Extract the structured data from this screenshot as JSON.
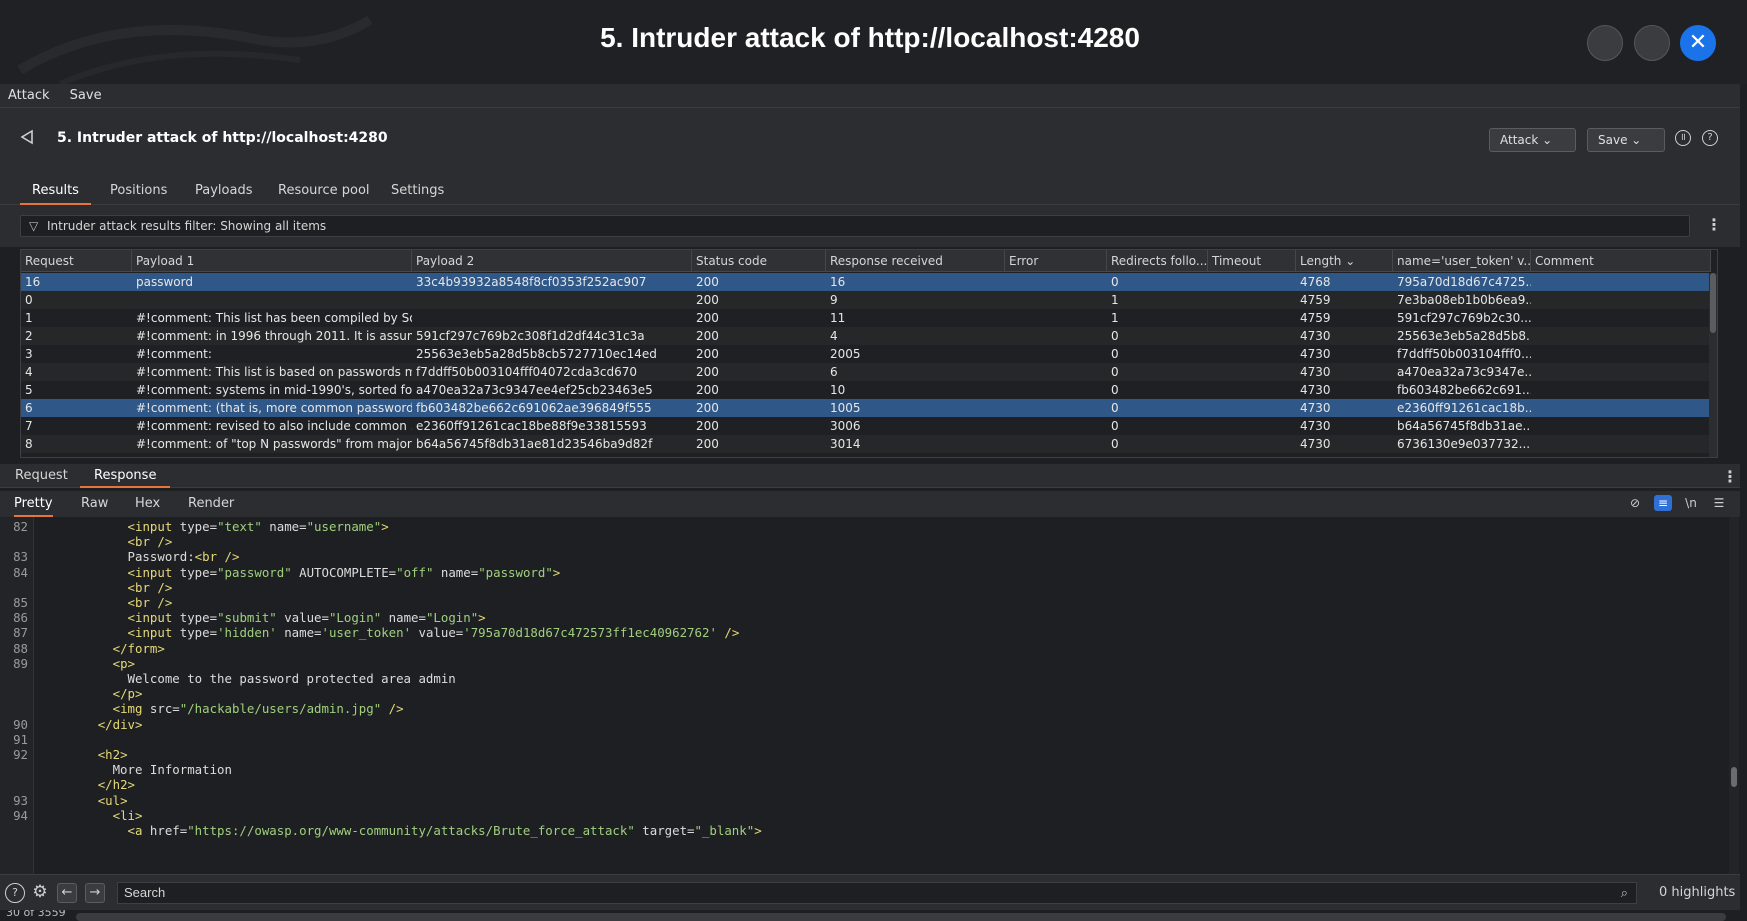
{
  "window": {
    "title": "5. Intruder attack of http://localhost:4280",
    "accent_color": "#1a73e8",
    "tab_underline_color": "#e8743b"
  },
  "menubar": {
    "attack": "Attack",
    "save": "Save"
  },
  "header": {
    "title": "5. Intruder attack of http://localhost:4280",
    "attack_button": "Attack",
    "save_button": "Save"
  },
  "tabs": [
    "Results",
    "Positions",
    "Payloads",
    "Resource pool",
    "Settings"
  ],
  "filter": {
    "text": "Intruder attack results filter: Showing all items"
  },
  "table": {
    "columns": [
      "Request",
      "Payload 1",
      "Payload 2",
      "Status code",
      "Response received",
      "Error",
      "Redirects follo...",
      "Timeout",
      "Length",
      "name='user_token' v...",
      "Comment"
    ],
    "rows": [
      [
        "16",
        "password",
        "33c4b93932a8548f8cf0353f252ac907",
        "200",
        "16",
        "",
        "0",
        "",
        "4768",
        "795a70d18d67c4725...",
        ""
      ],
      [
        "0",
        "",
        "",
        "200",
        "9",
        "",
        "1",
        "",
        "4759",
        "7e3ba08eb1b0b6ea9...",
        ""
      ],
      [
        "1",
        "#!comment: This list has been compiled by Sol...",
        "",
        "200",
        "11",
        "",
        "1",
        "",
        "4759",
        "591cf297c769b2c30...",
        ""
      ],
      [
        "2",
        "#!comment: in 1996 through 2011.  It is assum...",
        "591cf297c769b2c308f1d2df44c31c3a",
        "200",
        "4",
        "",
        "0",
        "",
        "4730",
        "25563e3eb5a28d5b8...",
        ""
      ],
      [
        "3",
        "#!comment:",
        "25563e3eb5a28d5b8cb5727710ec14ed",
        "200",
        "2005",
        "",
        "0",
        "",
        "4730",
        "f7ddff50b003104fff0...",
        ""
      ],
      [
        "4",
        "#!comment: This list is based on passwords m...",
        "f7ddff50b003104fff04072cda3cd670",
        "200",
        "6",
        "",
        "0",
        "",
        "4730",
        "a470ea32a73c9347e...",
        ""
      ],
      [
        "5",
        "#!comment: systems in mid-1990's, sorted fo...",
        "a470ea32a73c9347ee4ef25cb23463e5",
        "200",
        "10",
        "",
        "0",
        "",
        "4730",
        "fb603482be662c691...",
        ""
      ],
      [
        "6",
        "#!comment: (that is, more common password...",
        "fb603482be662c691062ae396849f555",
        "200",
        "1005",
        "",
        "0",
        "",
        "4730",
        "e2360ff91261cac18b...",
        ""
      ],
      [
        "7",
        "#!comment: revised to also include common ...",
        "e2360ff91261cac18be88f9e33815593",
        "200",
        "3006",
        "",
        "0",
        "",
        "4730",
        "b64a56745f8db31ae...",
        ""
      ],
      [
        "8",
        "#!comment: of \"top N passwords\" from major...",
        "b64a56745f8db31ae81d23546ba9d82f",
        "200",
        "3014",
        "",
        "0",
        "",
        "4730",
        "6736130e9e037732...",
        ""
      ]
    ]
  },
  "bottom_tabs": {
    "request": "Request",
    "response": "Response"
  },
  "view_tabs": [
    "Pretty",
    "Raw",
    "Hex",
    "Render"
  ],
  "view_wrap_label": "\\n",
  "code_lines": [
    {
      "n": "82",
      "t": "            <input type=\"text\" name=\"username\">"
    },
    {
      "n": "",
      "t": "            <br />"
    },
    {
      "n": "83",
      "t": "            Password:<br />"
    },
    {
      "n": "84",
      "t": "            <input type=\"password\" AUTOCOMPLETE=\"off\" name=\"password\">"
    },
    {
      "n": "",
      "t": "            <br />"
    },
    {
      "n": "85",
      "t": "            <br />"
    },
    {
      "n": "86",
      "t": "            <input type=\"submit\" value=\"Login\" name=\"Login\">"
    },
    {
      "n": "87",
      "t": "            <input type='hidden' name='user_token' value='795a70d18d67c472573ff1ec40962762' />"
    },
    {
      "n": "88",
      "t": "          </form>"
    },
    {
      "n": "89",
      "t": "          <p>"
    },
    {
      "n": "",
      "t": "            Welcome to the password protected area admin"
    },
    {
      "n": "",
      "t": "          </p>"
    },
    {
      "n": "",
      "t": "          <img src=\"/hackable/users/admin.jpg\" />"
    },
    {
      "n": "90",
      "t": "        </div>"
    },
    {
      "n": "91",
      "t": ""
    },
    {
      "n": "92",
      "t": "        <h2>"
    },
    {
      "n": "",
      "t": "          More Information"
    },
    {
      "n": "",
      "t": "        </h2>"
    },
    {
      "n": "93",
      "t": "        <ul>"
    },
    {
      "n": "94",
      "t": "          <li>"
    },
    {
      "n": "",
      "t": "            <a href=\"https://owasp.org/www-community/attacks/Brute_force_attack\" target=\"_blank\">"
    }
  ],
  "search": {
    "placeholder": "Search"
  },
  "highlights": "0 highlights",
  "status": "30 of 3559"
}
